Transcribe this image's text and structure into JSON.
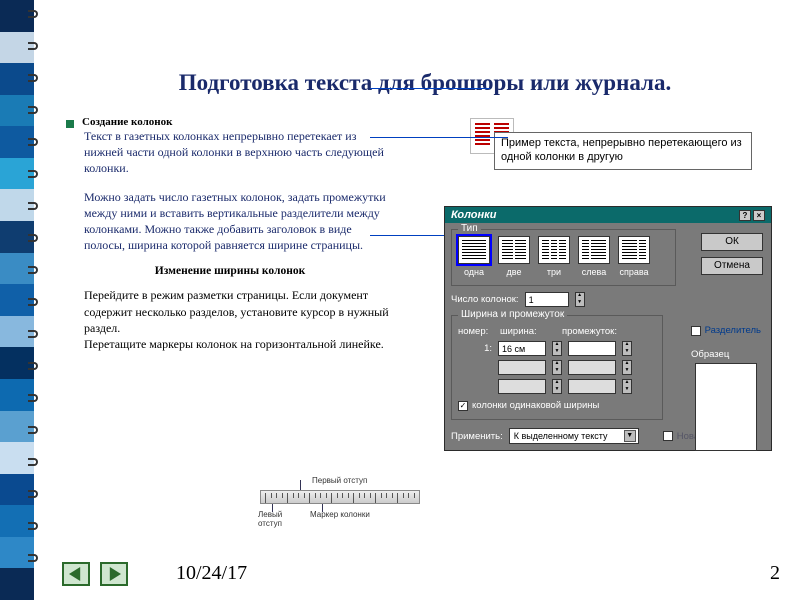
{
  "spiral_colors": [
    "#0a2a55",
    "#c4d6e6",
    "#0b4a8c",
    "#1a7bb5",
    "#0e5aa0",
    "#2aa4d6",
    "#c0d8ea",
    "#0f3d70",
    "#3a8cc4",
    "#1060a8",
    "#88b8de",
    "#043060",
    "#0d6ab0",
    "#5aa0d0",
    "#c9def0",
    "#0a4a90",
    "#136fb4",
    "#2e88c7",
    "#0a2a55"
  ],
  "title": "Подготовка текста для брошюры или журнала.",
  "bullet_heading": "Создание колонок",
  "para1": "Текст в газетных колонках непрерывно перетекает из нижней части одной колонки в верхнюю часть следующей колонки.",
  "para2": "Можно задать число газетных колонок, задать промежутки между ними и вставить вертикальные разделители между колонками. Можно также добавить заголовок в виде полосы, ширина которой равняется ширине страницы.",
  "subheading": "Изменение ширины колонок",
  "para3": "Перейдите в режим разметки страницы. Если документ содержит несколько разделов, установите курсор в нужный раздел.\nПеретащите маркеры колонок на горизонтальной линейке.",
  "caption": "Пример текста, непрерывно перетекающего из одной колонки в другую",
  "dialog": {
    "title": "Колонки",
    "ok": "ОК",
    "cancel": "Отмена",
    "group_type": "Тип",
    "types": [
      "одна",
      "две",
      "три",
      "слева",
      "справа"
    ],
    "divider": "Разделитель",
    "num_label": "Число колонок:",
    "num_value": "1",
    "width_group": "Ширина и промежуток",
    "hdr_num": "номер:",
    "hdr_width": "ширина:",
    "hdr_gap": "промежуток:",
    "row_num": "1:",
    "row_width": "16 см",
    "equal": "колонки одинаковой ширины",
    "sample": "Образец",
    "apply_label": "Применить:",
    "apply_value": "К выделенному тексту",
    "new_col": "Новая колонка"
  },
  "ruler": {
    "top_label": "Первый отступ",
    "left_label": "Левый отступ",
    "marker_label": "Маркер колонки"
  },
  "footer": {
    "date": "10/24/17",
    "page": "2"
  }
}
